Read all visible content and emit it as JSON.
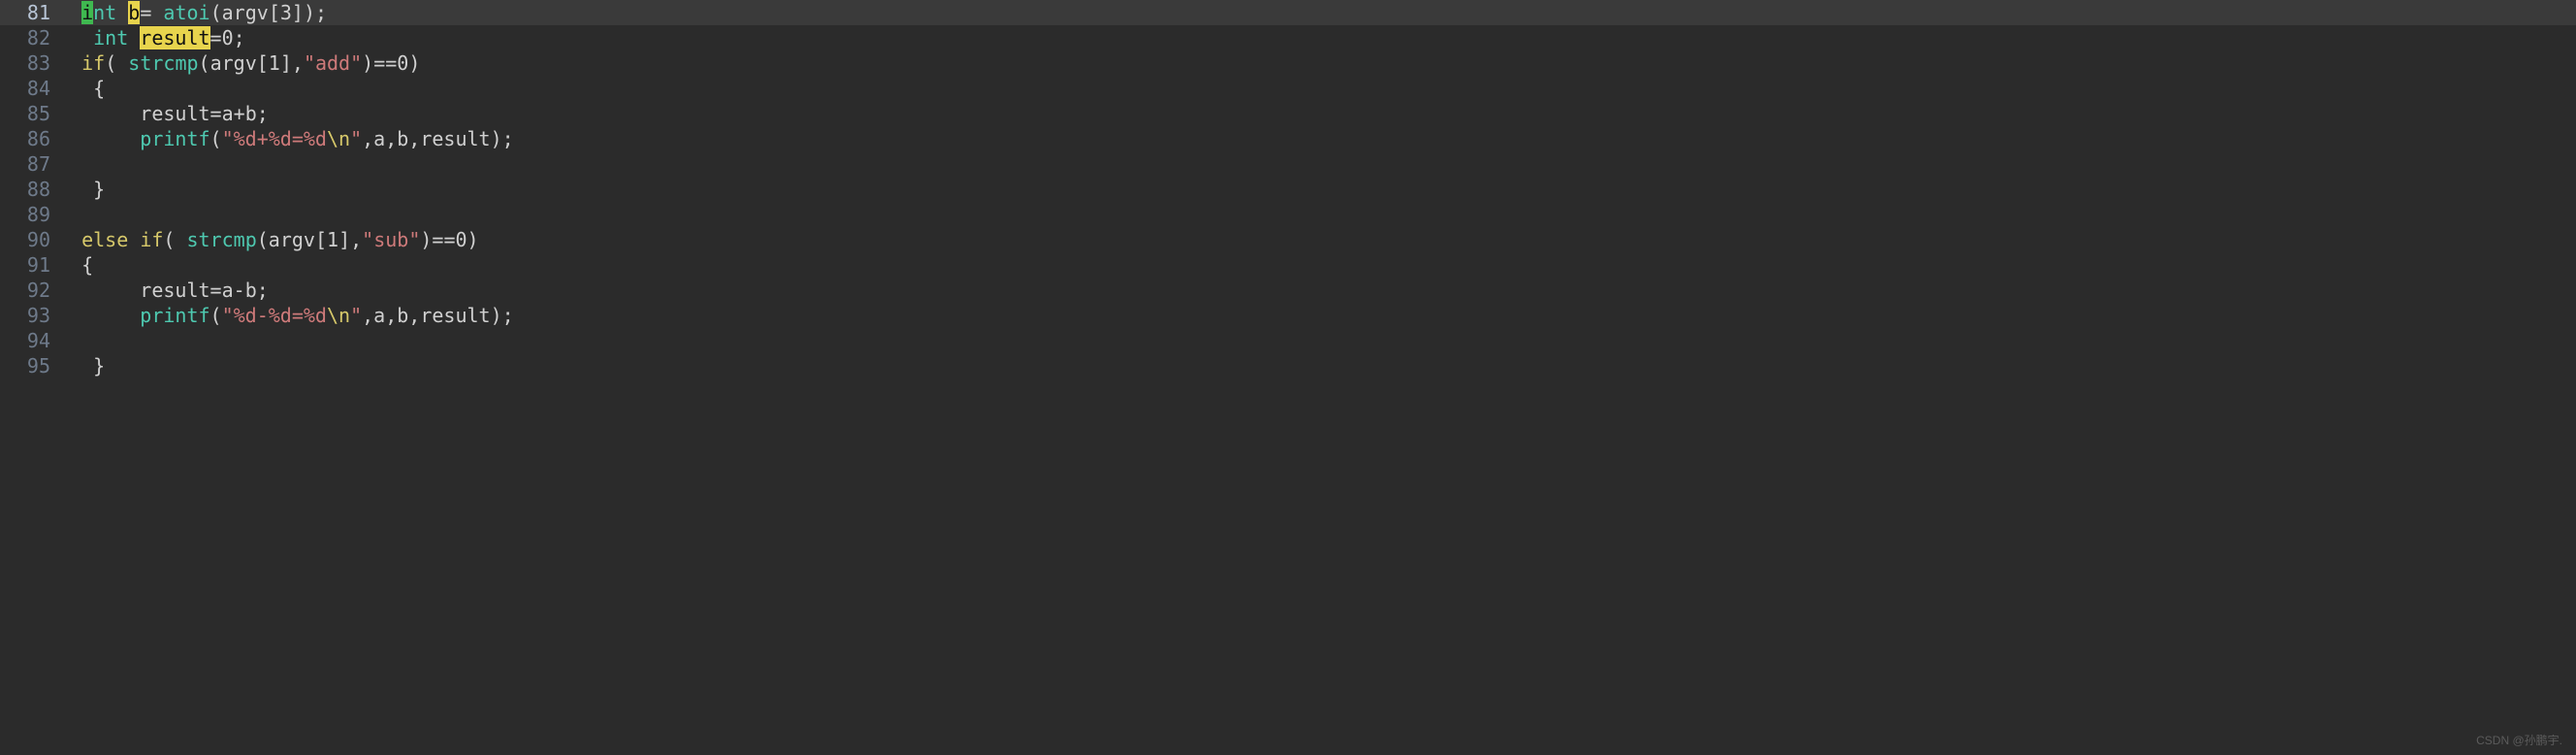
{
  "editor": {
    "startLine": 81,
    "currentLine": 81,
    "lines": [
      {
        "ln": "81",
        "tokens": [
          {
            "t": "  ",
            "c": ""
          },
          {
            "t": "i",
            "c": "hl-green"
          },
          {
            "t": "nt",
            "c": "kw-type"
          },
          {
            "t": " ",
            "c": ""
          },
          {
            "t": "b",
            "c": "hl-yellow"
          },
          {
            "t": "= ",
            "c": "punct"
          },
          {
            "t": "atoi",
            "c": "func"
          },
          {
            "t": "(",
            "c": "paren"
          },
          {
            "t": "argv",
            "c": "ident"
          },
          {
            "t": "[",
            "c": "punct"
          },
          {
            "t": "3",
            "c": "num"
          },
          {
            "t": "]);",
            "c": "punct"
          }
        ]
      },
      {
        "ln": "82",
        "tokens": [
          {
            "t": "   ",
            "c": ""
          },
          {
            "t": "int",
            "c": "kw-type"
          },
          {
            "t": " ",
            "c": ""
          },
          {
            "t": "result",
            "c": "hl-yellow"
          },
          {
            "t": "=",
            "c": "punct"
          },
          {
            "t": "0",
            "c": "num"
          },
          {
            "t": ";",
            "c": "punct"
          }
        ]
      },
      {
        "ln": "83",
        "tokens": [
          {
            "t": "  ",
            "c": ""
          },
          {
            "t": "if",
            "c": "kw-ctrl"
          },
          {
            "t": "( ",
            "c": "paren"
          },
          {
            "t": "strcmp",
            "c": "func"
          },
          {
            "t": "(",
            "c": "paren"
          },
          {
            "t": "argv",
            "c": "ident"
          },
          {
            "t": "[",
            "c": "punct"
          },
          {
            "t": "1",
            "c": "num"
          },
          {
            "t": "],",
            "c": "punct"
          },
          {
            "t": "\"add\"",
            "c": "str"
          },
          {
            "t": ")==",
            "c": "punct"
          },
          {
            "t": "0",
            "c": "num"
          },
          {
            "t": ")",
            "c": "paren"
          }
        ]
      },
      {
        "ln": "84",
        "tokens": [
          {
            "t": "   {",
            "c": "punct"
          }
        ]
      },
      {
        "ln": "85",
        "tokens": [
          {
            "t": "       ",
            "c": ""
          },
          {
            "t": "result",
            "c": "ident"
          },
          {
            "t": "=",
            "c": "punct"
          },
          {
            "t": "a",
            "c": "ident"
          },
          {
            "t": "+",
            "c": "punct"
          },
          {
            "t": "b",
            "c": "ident"
          },
          {
            "t": ";",
            "c": "punct"
          }
        ]
      },
      {
        "ln": "86",
        "tokens": [
          {
            "t": "       ",
            "c": ""
          },
          {
            "t": "printf",
            "c": "func"
          },
          {
            "t": "(",
            "c": "paren"
          },
          {
            "t": "\"%d+%d=%d",
            "c": "str"
          },
          {
            "t": "\\n",
            "c": "esc"
          },
          {
            "t": "\"",
            "c": "str"
          },
          {
            "t": ",",
            "c": "punct"
          },
          {
            "t": "a",
            "c": "ident"
          },
          {
            "t": ",",
            "c": "punct"
          },
          {
            "t": "b",
            "c": "ident"
          },
          {
            "t": ",",
            "c": "punct"
          },
          {
            "t": "result",
            "c": "ident"
          },
          {
            "t": ");",
            "c": "punct"
          }
        ]
      },
      {
        "ln": "87",
        "tokens": []
      },
      {
        "ln": "88",
        "tokens": [
          {
            "t": "   }",
            "c": "punct"
          }
        ]
      },
      {
        "ln": "89",
        "tokens": []
      },
      {
        "ln": "90",
        "tokens": [
          {
            "t": "  ",
            "c": ""
          },
          {
            "t": "else",
            "c": "kw-ctrl"
          },
          {
            "t": " ",
            "c": ""
          },
          {
            "t": "if",
            "c": "kw-ctrl"
          },
          {
            "t": "( ",
            "c": "paren"
          },
          {
            "t": "strcmp",
            "c": "func"
          },
          {
            "t": "(",
            "c": "paren"
          },
          {
            "t": "argv",
            "c": "ident"
          },
          {
            "t": "[",
            "c": "punct"
          },
          {
            "t": "1",
            "c": "num"
          },
          {
            "t": "],",
            "c": "punct"
          },
          {
            "t": "\"sub\"",
            "c": "str"
          },
          {
            "t": ")==",
            "c": "punct"
          },
          {
            "t": "0",
            "c": "num"
          },
          {
            "t": ")",
            "c": "paren"
          }
        ]
      },
      {
        "ln": "91",
        "tokens": [
          {
            "t": "  {",
            "c": "punct"
          }
        ]
      },
      {
        "ln": "92",
        "tokens": [
          {
            "t": "       ",
            "c": ""
          },
          {
            "t": "result",
            "c": "ident"
          },
          {
            "t": "=",
            "c": "punct"
          },
          {
            "t": "a",
            "c": "ident"
          },
          {
            "t": "-",
            "c": "punct"
          },
          {
            "t": "b",
            "c": "ident"
          },
          {
            "t": ";",
            "c": "punct"
          }
        ]
      },
      {
        "ln": "93",
        "tokens": [
          {
            "t": "       ",
            "c": ""
          },
          {
            "t": "printf",
            "c": "func"
          },
          {
            "t": "(",
            "c": "paren"
          },
          {
            "t": "\"%d-%d=%d",
            "c": "str"
          },
          {
            "t": "\\n",
            "c": "esc"
          },
          {
            "t": "\"",
            "c": "str"
          },
          {
            "t": ",",
            "c": "punct"
          },
          {
            "t": "a",
            "c": "ident"
          },
          {
            "t": ",",
            "c": "punct"
          },
          {
            "t": "b",
            "c": "ident"
          },
          {
            "t": ",",
            "c": "punct"
          },
          {
            "t": "result",
            "c": "ident"
          },
          {
            "t": ");",
            "c": "punct"
          }
        ]
      },
      {
        "ln": "94",
        "tokens": []
      },
      {
        "ln": "95",
        "tokens": [
          {
            "t": "   }",
            "c": "punct"
          }
        ]
      }
    ]
  },
  "watermark": "CSDN @孙鹏宇."
}
